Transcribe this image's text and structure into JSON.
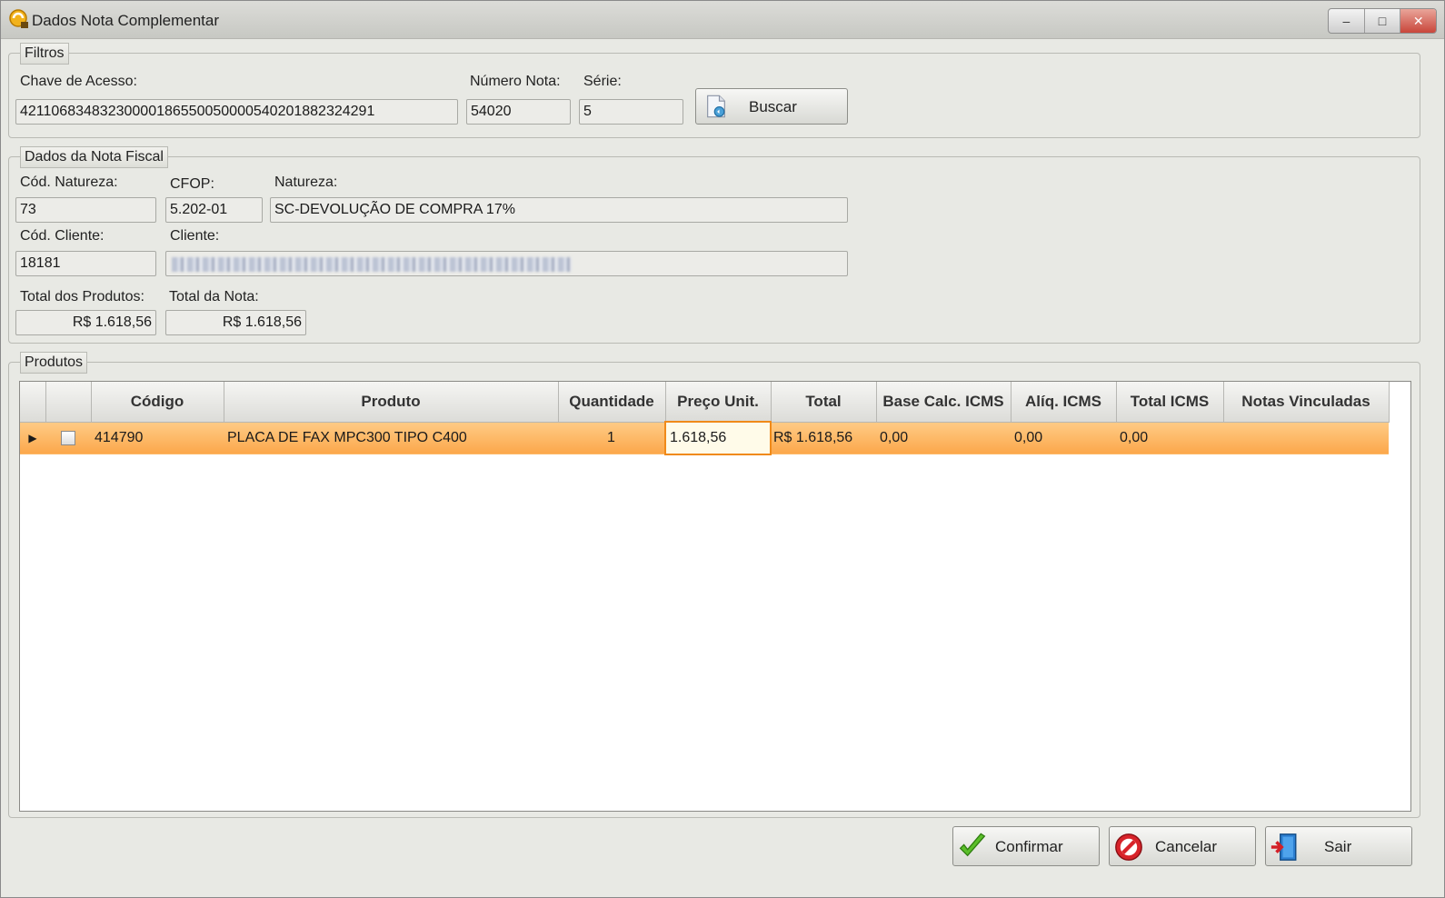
{
  "window": {
    "title": "Dados Nota Complementar"
  },
  "filtros": {
    "legend": "Filtros",
    "chave_label": "Chave de Acesso:",
    "chave_value": "42110683483230000186550050000540201882324291",
    "numero_label": "Número Nota:",
    "numero_value": "54020",
    "serie_label": "Série:",
    "serie_value": "5",
    "buscar_label": "Buscar"
  },
  "nota": {
    "legend": "Dados da Nota Fiscal",
    "cod_natureza_label": "Cód. Natureza:",
    "cod_natureza_value": "73",
    "cfop_label": "CFOP:",
    "cfop_value": "5.202-01",
    "natureza_label": "Natureza:",
    "natureza_value": "SC-DEVOLUÇÃO DE COMPRA 17%",
    "cod_cliente_label": "Cód. Cliente:",
    "cod_cliente_value": "18181",
    "cliente_label": "Cliente:",
    "total_produtos_label": "Total dos Produtos:",
    "total_produtos_value": "R$ 1.618,56",
    "total_nota_label": "Total da Nota:",
    "total_nota_value": "R$ 1.618,56"
  },
  "produtos": {
    "legend": "Produtos",
    "columns": [
      "Código",
      "Produto",
      "Quantidade",
      "Preço Unit.",
      "Total",
      "Base Calc. ICMS",
      "Alíq. ICMS",
      "Total ICMS",
      "Notas Vinculadas"
    ],
    "rows": [
      {
        "codigo": "414790",
        "produto": "PLACA DE FAX MPC300 TIPO C400",
        "quantidade": "1",
        "preco": "1.618,56",
        "total": "R$ 1.618,56",
        "base": "0,00",
        "aliq": "0,00",
        "total_icms": "0,00",
        "notas": ""
      }
    ]
  },
  "buttons": {
    "confirmar": "Confirmar",
    "cancelar": "Cancelar",
    "sair": "Sair"
  },
  "colors": {
    "selected_row": "#fdb865",
    "edit_cell_border": "#f08a19"
  }
}
